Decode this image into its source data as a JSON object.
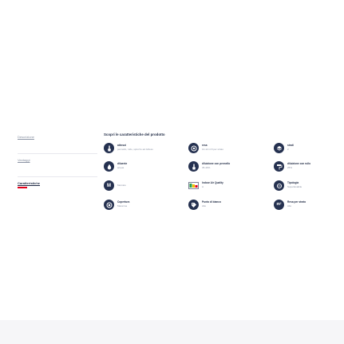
{
  "tabs": [
    {
      "label": "Descrizione",
      "active": false
    },
    {
      "label": "Vantaggi",
      "active": false
    },
    {
      "label": "Caratteristiche",
      "active": true
    }
  ],
  "section": {
    "title": "Scopri le caratteristiche del prodotto"
  },
  "features": {
    "attrezzi": {
      "label": "attrezzi",
      "value": "pennello, rullo, spruzzo ad Airless",
      "icon": "brush-icon"
    },
    "diluente": {
      "label": "diluente",
      "value": "acqua",
      "icon": "drop-icon"
    },
    "mercato": {
      "label": "",
      "value": "Mercato",
      "icon": "m-letter-icon"
    },
    "copertura": {
      "label": "Copertura",
      "value": "Massima",
      "icon": "coverage-icon"
    },
    "resa": {
      "label": "resa",
      "value": "10-12 m²/l per strato",
      "icon": "coverage-icon"
    },
    "diluizione_pennello": {
      "label": "diluizione con pennello",
      "value": "35-40%",
      "icon": "brush-icon"
    },
    "indoor_air": {
      "label": "Indoor Air Quality",
      "value": "A",
      "icon": "air-quality-icon"
    },
    "punto_bianco": {
      "label": "Punto di bianco",
      "value": "Alto",
      "icon": "tag-icon"
    },
    "strati": {
      "label": "strati",
      "value": "2",
      "icon": "layers-icon"
    },
    "diluizione_rullo": {
      "label": "diluizione con rullo",
      "value": "25%",
      "icon": "roller-icon"
    },
    "tipologia": {
      "label": "Tipologia",
      "value": "Superlavabile",
      "icon": "wash-icon"
    },
    "resa_strato": {
      "label": "Resa per strato",
      "value": "Alto",
      "icon": "m2-icon"
    }
  }
}
